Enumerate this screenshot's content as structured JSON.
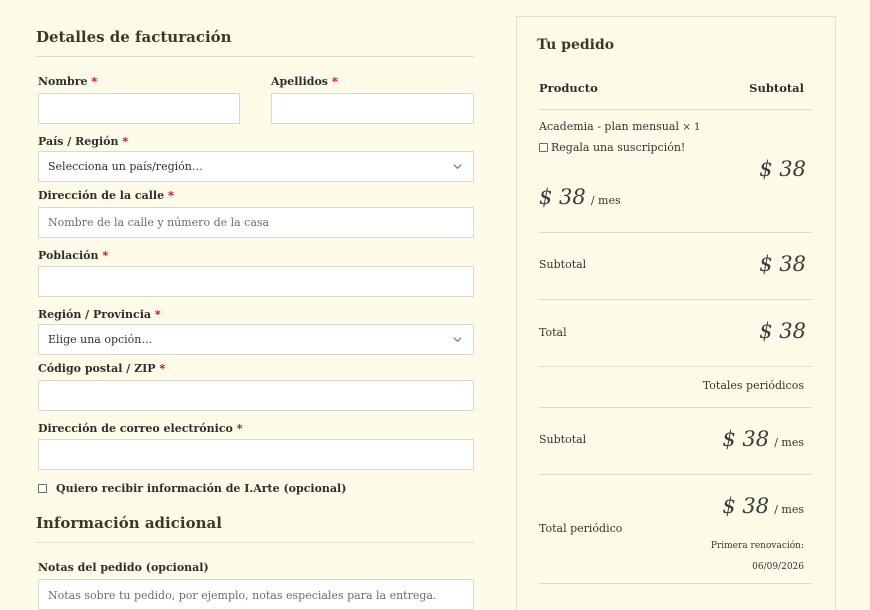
{
  "billing": {
    "title": "Detalles de facturación",
    "first_name": {
      "label": "Nombre",
      "value": ""
    },
    "last_name": {
      "label": "Apellidos",
      "value": ""
    },
    "country": {
      "label": "País / Región",
      "selected": "Selecciona un país/región…"
    },
    "street": {
      "label": "Dirección de la calle",
      "placeholder": "Nombre de la calle y número de la casa"
    },
    "city": {
      "label": "Población",
      "value": ""
    },
    "state": {
      "label": "Región / Provincia",
      "selected": "Elige una opción…"
    },
    "postcode": {
      "label": "Código postal / ZIP",
      "value": ""
    },
    "email": {
      "label": "Dirección de correo electrónico",
      "value": ""
    },
    "required_mark": "*",
    "newsletter_label": "Quiero recibir información de I.Arte (opcional)",
    "newsletter_checked": false
  },
  "additional": {
    "title": "Información adicional",
    "notes_label": "Notas del pedido (opcional)",
    "notes_placeholder": "Notas sobre tu pedido, por ejemplo, notas especiales para la entrega."
  },
  "order": {
    "title": "Tu pedido",
    "col_product": "Producto",
    "col_subtotal": "Subtotal",
    "item_name": "Academia - plan mensual",
    "item_qty": "× 1",
    "gift_label": "Regala una suscripción!",
    "gift_checked": false,
    "item_price": "$ 38",
    "item_recurring_price": "$ 38",
    "per_month": "/ mes",
    "subtotal_label": "Subtotal",
    "subtotal_value": "$ 38",
    "total_label": "Total",
    "total_value": "$ 38",
    "recurring_heading": "Totales periódicos",
    "recurring_subtotal_label": "Subtotal",
    "recurring_subtotal_value": "$ 38",
    "recurring_total_label": "Total periódico",
    "recurring_total_value": "$ 38",
    "renewal_label": "Primera renovación:",
    "renewal_date": "06/09/2026"
  },
  "icons": {
    "select_arrow": "chevron-down-icon",
    "checkbox": "checkbox-icon"
  },
  "colors": {
    "background": "#fefce8",
    "required": "#d00000",
    "border": "#d7d7d7"
  }
}
